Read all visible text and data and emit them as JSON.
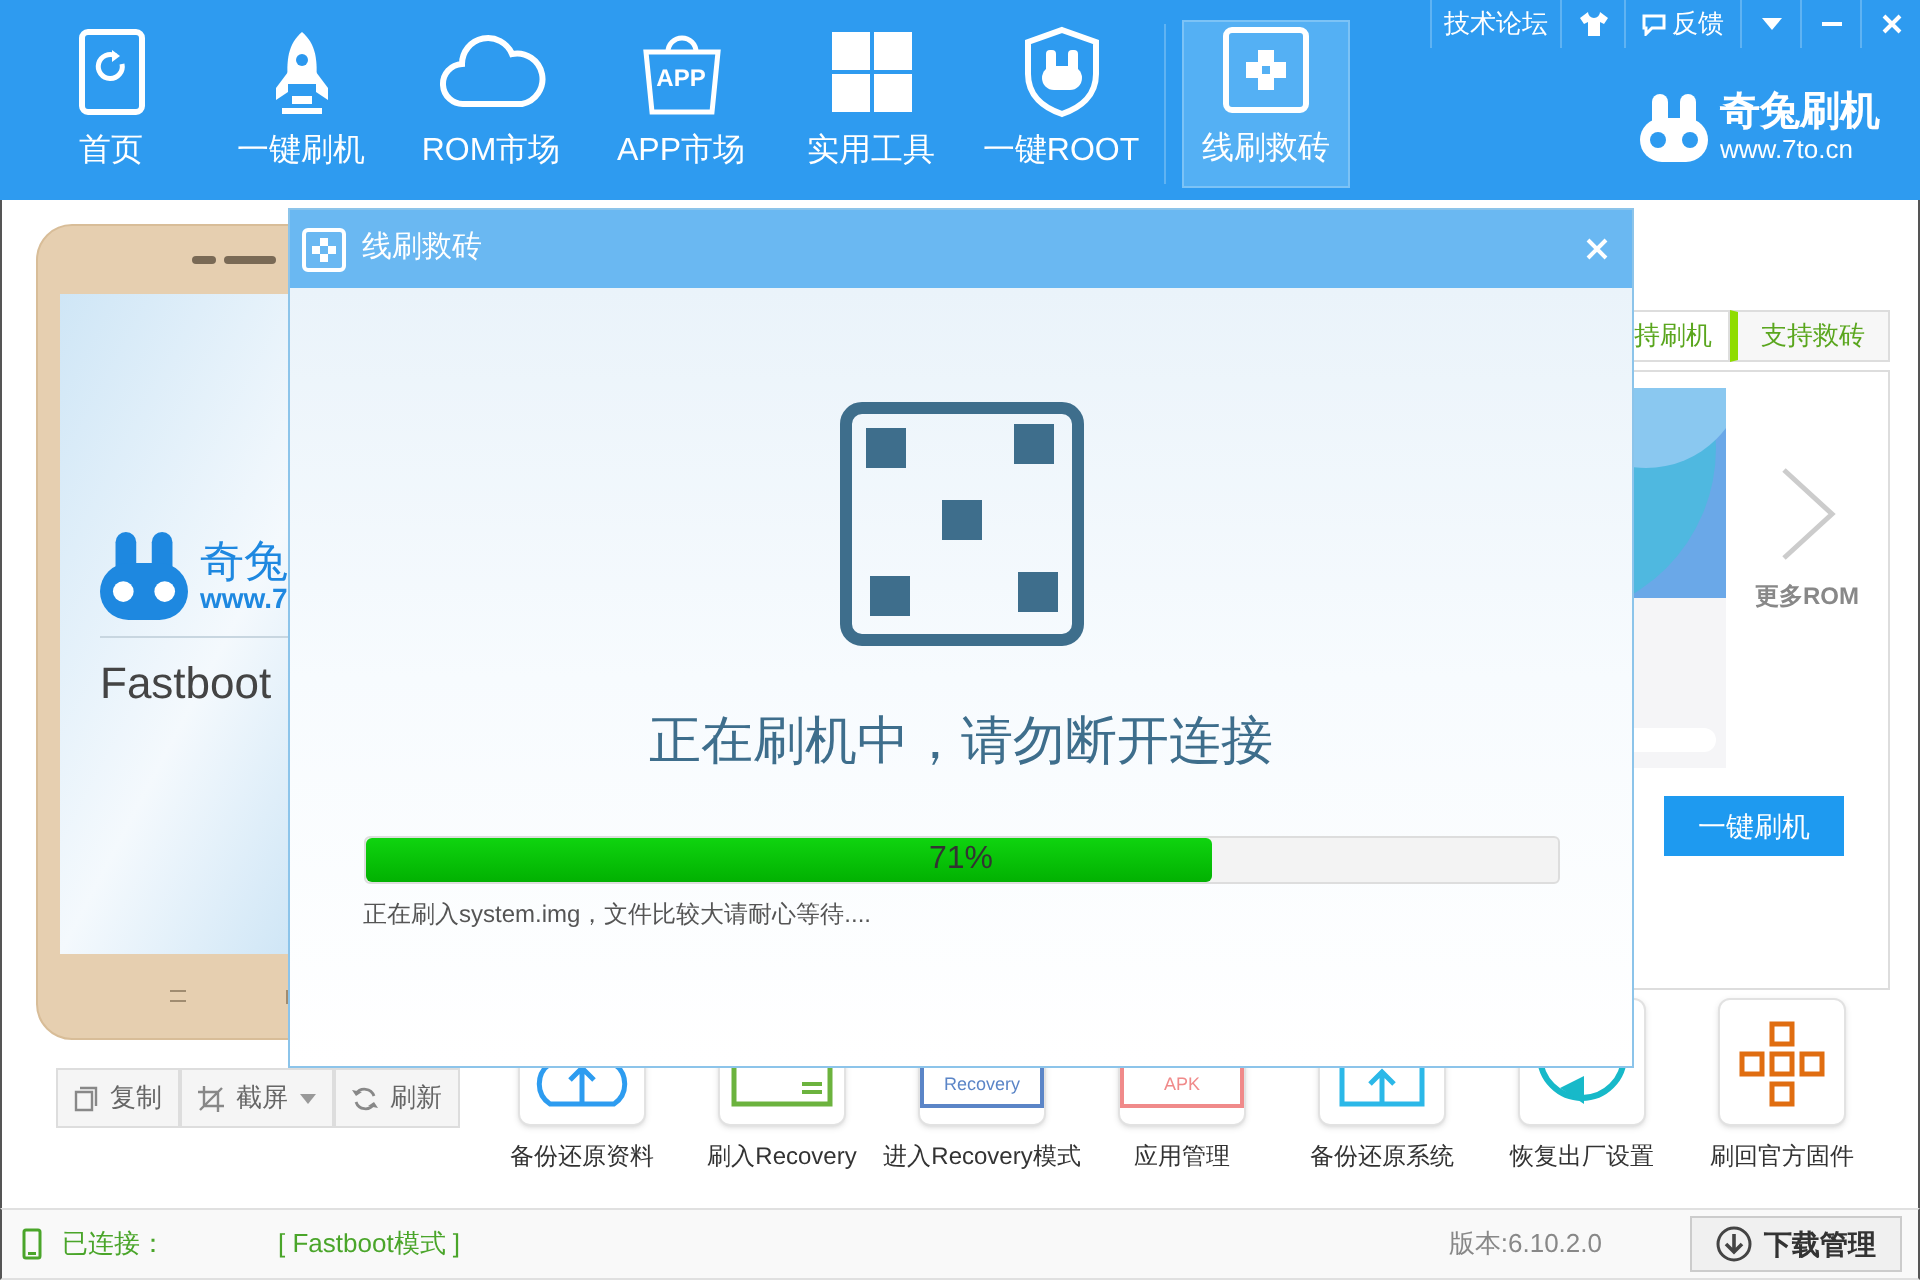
{
  "nav": [
    {
      "label": "首页",
      "kind": "home",
      "selected": false
    },
    {
      "label": "一键刷机",
      "kind": "rocket",
      "selected": false
    },
    {
      "label": "ROM市场",
      "kind": "cloud",
      "selected": false
    },
    {
      "label": "APP市场",
      "kind": "bag",
      "badge": "APP",
      "selected": false
    },
    {
      "label": "实用工具",
      "kind": "grid",
      "selected": false
    },
    {
      "label": "一键ROOT",
      "kind": "shield",
      "selected": false
    },
    {
      "label": "线刷救砖",
      "kind": "cross",
      "selected": true
    }
  ],
  "window_controls": {
    "forum": "技术论坛",
    "feedback": "反馈"
  },
  "brand": {
    "name": "奇兔刷机",
    "url": "www.7to.cn"
  },
  "phone_screen": {
    "logo_name": "奇兔",
    "logo_url": "www.7",
    "mode": "Fastboot"
  },
  "phone_toolbar": [
    {
      "label": "复制",
      "kind": "copy"
    },
    {
      "label": "截屏",
      "kind": "screenshot"
    },
    {
      "label": "刷新",
      "kind": "refresh"
    }
  ],
  "rom_panel": {
    "tabs": [
      {
        "label": "持刷机",
        "selected": false
      },
      {
        "label": "支持救砖",
        "selected": true
      }
    ],
    "more": "更多ROM",
    "flash_button": "一键刷机"
  },
  "tools": [
    {
      "label": "备份还原资料",
      "kind": "cloud"
    },
    {
      "label": "刷入Recovery",
      "kind": "card"
    },
    {
      "label": "进入Recovery模式",
      "kind": "recovery",
      "badge": "Recovery"
    },
    {
      "label": "应用管理",
      "kind": "apk",
      "badge": "APK"
    },
    {
      "label": "备份还原系统",
      "kind": "box"
    },
    {
      "label": "恢复出厂设置",
      "kind": "restore"
    },
    {
      "label": "刷回官方固件",
      "kind": "firmware"
    }
  ],
  "status_bar": {
    "connected": "已连接：",
    "mode": "[ Fastboot模式 ]",
    "version": "版本:6.10.2.0",
    "download": "下载管理"
  },
  "dialog": {
    "title": "线刷救砖",
    "message": "正在刷机中，请勿断开连接",
    "progress": {
      "level": 0.71,
      "reading": "71%"
    },
    "detail": "正在刷入system.img，文件比较大请耐心等待...."
  }
}
